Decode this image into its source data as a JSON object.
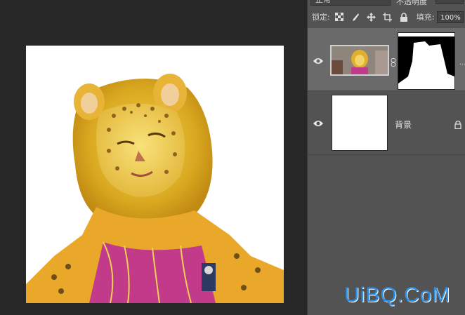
{
  "options_bar": {
    "blend_mode": "正常",
    "opacity_label": "不透明度"
  },
  "lock_bar": {
    "lock_label": "锁定:",
    "fill_label": "填充:",
    "fill_value": "100%",
    "icons": [
      "lock-transparent-pixels-icon",
      "lock-image-pixels-icon",
      "lock-position-icon",
      "lock-artboard-icon",
      "lock-all-icon"
    ]
  },
  "layers": [
    {
      "name": "",
      "visible": true,
      "has_mask": true,
      "more": "..."
    },
    {
      "name": "背景",
      "visible": true,
      "locked": true
    }
  ],
  "watermark": "UiBQ.CoM",
  "colors": {
    "panel_bg": "#535353",
    "selected_layer_bg": "#6a6a6a",
    "canvas_bg": "#282828",
    "watermark": "#2c8fe8"
  }
}
